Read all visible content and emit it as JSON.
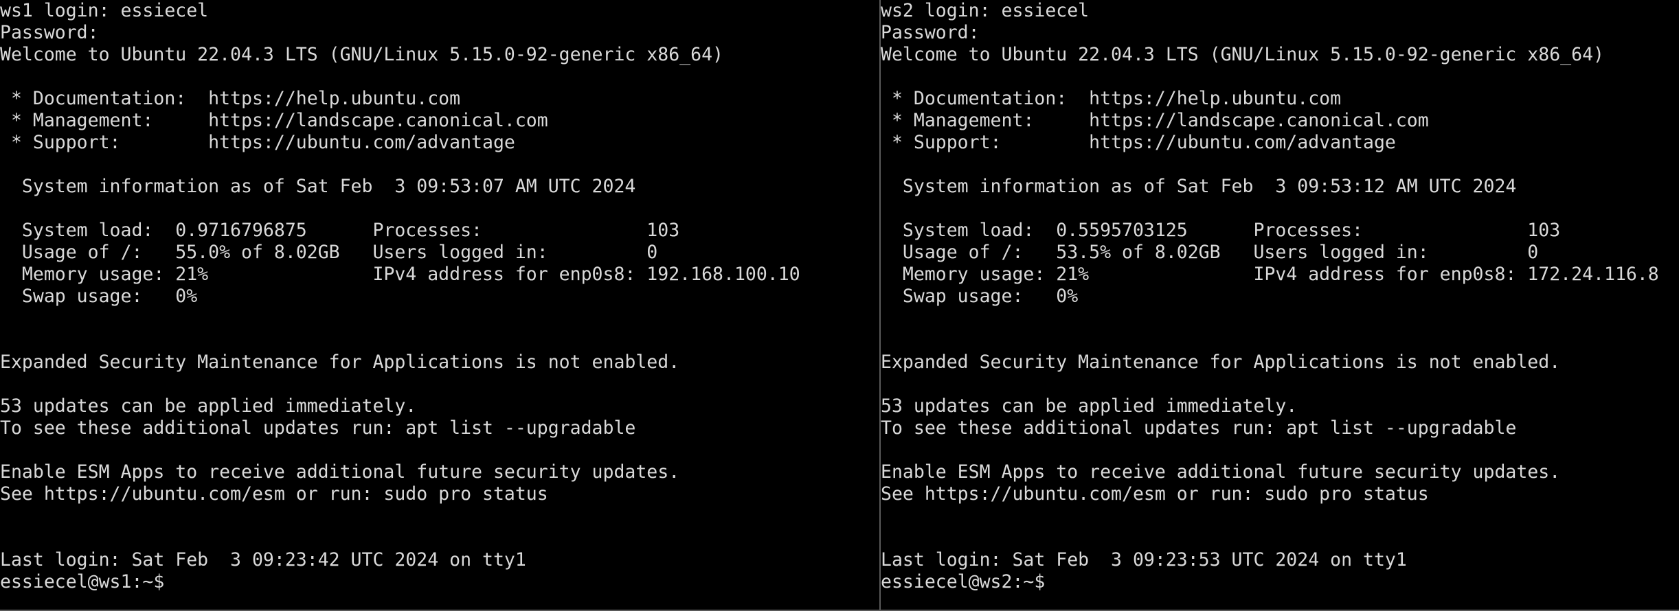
{
  "terminals": [
    {
      "lines": [
        "ws1 login: essiecel",
        "Password:",
        "Welcome to Ubuntu 22.04.3 LTS (GNU/Linux 5.15.0-92-generic x86_64)",
        "",
        " * Documentation:  https://help.ubuntu.com",
        " * Management:     https://landscape.canonical.com",
        " * Support:        https://ubuntu.com/advantage",
        "",
        "  System information as of Sat Feb  3 09:53:07 AM UTC 2024",
        "",
        "  System load:  0.9716796875      Processes:               103",
        "  Usage of /:   55.0% of 8.02GB   Users logged in:         0",
        "  Memory usage: 21%               IPv4 address for enp0s8: 192.168.100.10",
        "  Swap usage:   0%",
        "",
        "",
        "Expanded Security Maintenance for Applications is not enabled.",
        "",
        "53 updates can be applied immediately.",
        "To see these additional updates run: apt list --upgradable",
        "",
        "Enable ESM Apps to receive additional future security updates.",
        "See https://ubuntu.com/esm or run: sudo pro status",
        "",
        "",
        "Last login: Sat Feb  3 09:23:42 UTC 2024 on tty1",
        "essiecel@ws1:~$"
      ]
    },
    {
      "lines": [
        "ws2 login: essiecel",
        "Password:",
        "Welcome to Ubuntu 22.04.3 LTS (GNU/Linux 5.15.0-92-generic x86_64)",
        "",
        " * Documentation:  https://help.ubuntu.com",
        " * Management:     https://landscape.canonical.com",
        " * Support:        https://ubuntu.com/advantage",
        "",
        "  System information as of Sat Feb  3 09:53:12 AM UTC 2024",
        "",
        "  System load:  0.5595703125      Processes:               103",
        "  Usage of /:   53.5% of 8.02GB   Users logged in:         0",
        "  Memory usage: 21%               IPv4 address for enp0s8: 172.24.116.8",
        "  Swap usage:   0%",
        "",
        "",
        "Expanded Security Maintenance for Applications is not enabled.",
        "",
        "53 updates can be applied immediately.",
        "To see these additional updates run: apt list --upgradable",
        "",
        "Enable ESM Apps to receive additional future security updates.",
        "See https://ubuntu.com/esm or run: sudo pro status",
        "",
        "",
        "Last login: Sat Feb  3 09:23:53 UTC 2024 on tty1",
        "essiecel@ws2:~$"
      ]
    }
  ]
}
